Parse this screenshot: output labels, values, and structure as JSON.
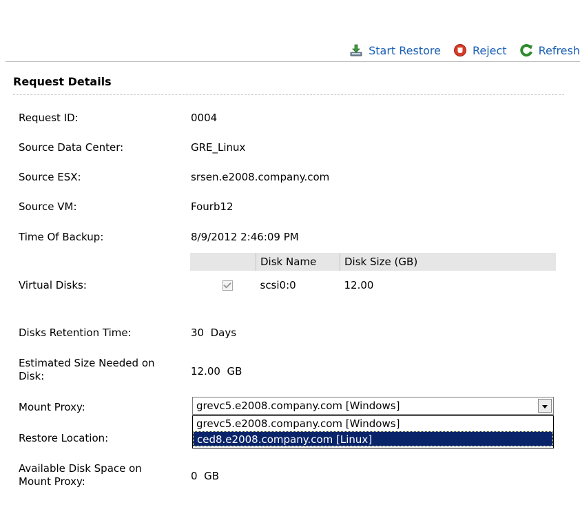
{
  "toolbar": {
    "start_restore": "Start Restore",
    "reject": "Reject",
    "refresh": "Refresh",
    "icons": {
      "start_restore": "download-tray-icon",
      "reject": "stop-icon",
      "refresh": "refresh-icon"
    },
    "colors": {
      "link": "#1a5fb4",
      "reject_icon": "#d63b2a",
      "refresh_icon": "#2e8b2e"
    }
  },
  "section": {
    "title": "Request Details"
  },
  "fields": {
    "request_id": {
      "label": "Request ID:",
      "value": "0004"
    },
    "source_dc": {
      "label": "Source Data Center:",
      "value": "GRE_Linux"
    },
    "source_esx": {
      "label": "Source ESX:",
      "value": "srsen.e2008.company.com"
    },
    "source_vm": {
      "label": "Source VM:",
      "value": "Fourb12"
    },
    "time_of_backup": {
      "label": "Time Of Backup:",
      "value": "8/9/2012 2:46:09 PM"
    },
    "virtual_disks": {
      "label": "Virtual Disks:"
    },
    "retention": {
      "label": "Disks Retention Time:",
      "value": "30  Days"
    },
    "estimated_size": {
      "label_line1": "Estimated Size Needed on",
      "label_line2": "Disk:",
      "value": "12.00  GB"
    },
    "mount_proxy": {
      "label": "Mount Proxy:"
    },
    "restore_location": {
      "label": "Restore Location:"
    },
    "available_space": {
      "label_line1": "Available Disk Space on",
      "label_line2": "Mount Proxy:",
      "value": "0  GB"
    }
  },
  "disk_table": {
    "headers": [
      "",
      "Disk Name",
      "Disk Size (GB)"
    ],
    "rows": [
      {
        "checked": true,
        "name": "scsi0:0",
        "size": "12.00"
      }
    ]
  },
  "mount_proxy_select": {
    "selected": "grevc5.e2008.company.com [Windows]",
    "options": [
      "grevc5.e2008.company.com [Windows]",
      "ced8.e2008.company.com [Linux]"
    ],
    "highlighted_index": 1,
    "highlight_color": "#0a246a"
  }
}
